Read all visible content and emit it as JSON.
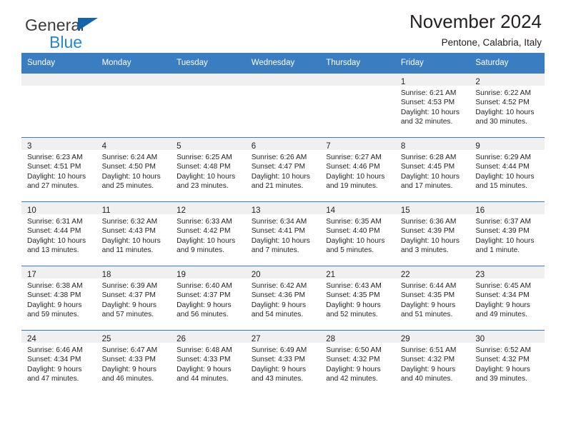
{
  "brand": {
    "line1": "General",
    "line2": "Blue",
    "flag_color": "#1463ad",
    "line2_color": "#2088d4"
  },
  "header": {
    "month_title": "November 2024",
    "location": "Pentone, Calabria, Italy"
  },
  "theme": {
    "header_blue": "#3a7dc0",
    "daynum_band": "#f0f0f0",
    "text": "#231f20"
  },
  "weekdays": [
    "Sunday",
    "Monday",
    "Tuesday",
    "Wednesday",
    "Thursday",
    "Friday",
    "Saturday"
  ],
  "weeks": [
    [
      {
        "day": "",
        "sunrise": "",
        "sunset": "",
        "daylight": ""
      },
      {
        "day": "",
        "sunrise": "",
        "sunset": "",
        "daylight": ""
      },
      {
        "day": "",
        "sunrise": "",
        "sunset": "",
        "daylight": ""
      },
      {
        "day": "",
        "sunrise": "",
        "sunset": "",
        "daylight": ""
      },
      {
        "day": "",
        "sunrise": "",
        "sunset": "",
        "daylight": ""
      },
      {
        "day": "1",
        "sunrise": "Sunrise: 6:21 AM",
        "sunset": "Sunset: 4:53 PM",
        "daylight": "Daylight: 10 hours and 32 minutes."
      },
      {
        "day": "2",
        "sunrise": "Sunrise: 6:22 AM",
        "sunset": "Sunset: 4:52 PM",
        "daylight": "Daylight: 10 hours and 30 minutes."
      }
    ],
    [
      {
        "day": "3",
        "sunrise": "Sunrise: 6:23 AM",
        "sunset": "Sunset: 4:51 PM",
        "daylight": "Daylight: 10 hours and 27 minutes."
      },
      {
        "day": "4",
        "sunrise": "Sunrise: 6:24 AM",
        "sunset": "Sunset: 4:50 PM",
        "daylight": "Daylight: 10 hours and 25 minutes."
      },
      {
        "day": "5",
        "sunrise": "Sunrise: 6:25 AM",
        "sunset": "Sunset: 4:48 PM",
        "daylight": "Daylight: 10 hours and 23 minutes."
      },
      {
        "day": "6",
        "sunrise": "Sunrise: 6:26 AM",
        "sunset": "Sunset: 4:47 PM",
        "daylight": "Daylight: 10 hours and 21 minutes."
      },
      {
        "day": "7",
        "sunrise": "Sunrise: 6:27 AM",
        "sunset": "Sunset: 4:46 PM",
        "daylight": "Daylight: 10 hours and 19 minutes."
      },
      {
        "day": "8",
        "sunrise": "Sunrise: 6:28 AM",
        "sunset": "Sunset: 4:45 PM",
        "daylight": "Daylight: 10 hours and 17 minutes."
      },
      {
        "day": "9",
        "sunrise": "Sunrise: 6:29 AM",
        "sunset": "Sunset: 4:44 PM",
        "daylight": "Daylight: 10 hours and 15 minutes."
      }
    ],
    [
      {
        "day": "10",
        "sunrise": "Sunrise: 6:31 AM",
        "sunset": "Sunset: 4:44 PM",
        "daylight": "Daylight: 10 hours and 13 minutes."
      },
      {
        "day": "11",
        "sunrise": "Sunrise: 6:32 AM",
        "sunset": "Sunset: 4:43 PM",
        "daylight": "Daylight: 10 hours and 11 minutes."
      },
      {
        "day": "12",
        "sunrise": "Sunrise: 6:33 AM",
        "sunset": "Sunset: 4:42 PM",
        "daylight": "Daylight: 10 hours and 9 minutes."
      },
      {
        "day": "13",
        "sunrise": "Sunrise: 6:34 AM",
        "sunset": "Sunset: 4:41 PM",
        "daylight": "Daylight: 10 hours and 7 minutes."
      },
      {
        "day": "14",
        "sunrise": "Sunrise: 6:35 AM",
        "sunset": "Sunset: 4:40 PM",
        "daylight": "Daylight: 10 hours and 5 minutes."
      },
      {
        "day": "15",
        "sunrise": "Sunrise: 6:36 AM",
        "sunset": "Sunset: 4:39 PM",
        "daylight": "Daylight: 10 hours and 3 minutes."
      },
      {
        "day": "16",
        "sunrise": "Sunrise: 6:37 AM",
        "sunset": "Sunset: 4:39 PM",
        "daylight": "Daylight: 10 hours and 1 minute."
      }
    ],
    [
      {
        "day": "17",
        "sunrise": "Sunrise: 6:38 AM",
        "sunset": "Sunset: 4:38 PM",
        "daylight": "Daylight: 9 hours and 59 minutes."
      },
      {
        "day": "18",
        "sunrise": "Sunrise: 6:39 AM",
        "sunset": "Sunset: 4:37 PM",
        "daylight": "Daylight: 9 hours and 57 minutes."
      },
      {
        "day": "19",
        "sunrise": "Sunrise: 6:40 AM",
        "sunset": "Sunset: 4:37 PM",
        "daylight": "Daylight: 9 hours and 56 minutes."
      },
      {
        "day": "20",
        "sunrise": "Sunrise: 6:42 AM",
        "sunset": "Sunset: 4:36 PM",
        "daylight": "Daylight: 9 hours and 54 minutes."
      },
      {
        "day": "21",
        "sunrise": "Sunrise: 6:43 AM",
        "sunset": "Sunset: 4:35 PM",
        "daylight": "Daylight: 9 hours and 52 minutes."
      },
      {
        "day": "22",
        "sunrise": "Sunrise: 6:44 AM",
        "sunset": "Sunset: 4:35 PM",
        "daylight": "Daylight: 9 hours and 51 minutes."
      },
      {
        "day": "23",
        "sunrise": "Sunrise: 6:45 AM",
        "sunset": "Sunset: 4:34 PM",
        "daylight": "Daylight: 9 hours and 49 minutes."
      }
    ],
    [
      {
        "day": "24",
        "sunrise": "Sunrise: 6:46 AM",
        "sunset": "Sunset: 4:34 PM",
        "daylight": "Daylight: 9 hours and 47 minutes."
      },
      {
        "day": "25",
        "sunrise": "Sunrise: 6:47 AM",
        "sunset": "Sunset: 4:33 PM",
        "daylight": "Daylight: 9 hours and 46 minutes."
      },
      {
        "day": "26",
        "sunrise": "Sunrise: 6:48 AM",
        "sunset": "Sunset: 4:33 PM",
        "daylight": "Daylight: 9 hours and 44 minutes."
      },
      {
        "day": "27",
        "sunrise": "Sunrise: 6:49 AM",
        "sunset": "Sunset: 4:33 PM",
        "daylight": "Daylight: 9 hours and 43 minutes."
      },
      {
        "day": "28",
        "sunrise": "Sunrise: 6:50 AM",
        "sunset": "Sunset: 4:32 PM",
        "daylight": "Daylight: 9 hours and 42 minutes."
      },
      {
        "day": "29",
        "sunrise": "Sunrise: 6:51 AM",
        "sunset": "Sunset: 4:32 PM",
        "daylight": "Daylight: 9 hours and 40 minutes."
      },
      {
        "day": "30",
        "sunrise": "Sunrise: 6:52 AM",
        "sunset": "Sunset: 4:32 PM",
        "daylight": "Daylight: 9 hours and 39 minutes."
      }
    ]
  ]
}
